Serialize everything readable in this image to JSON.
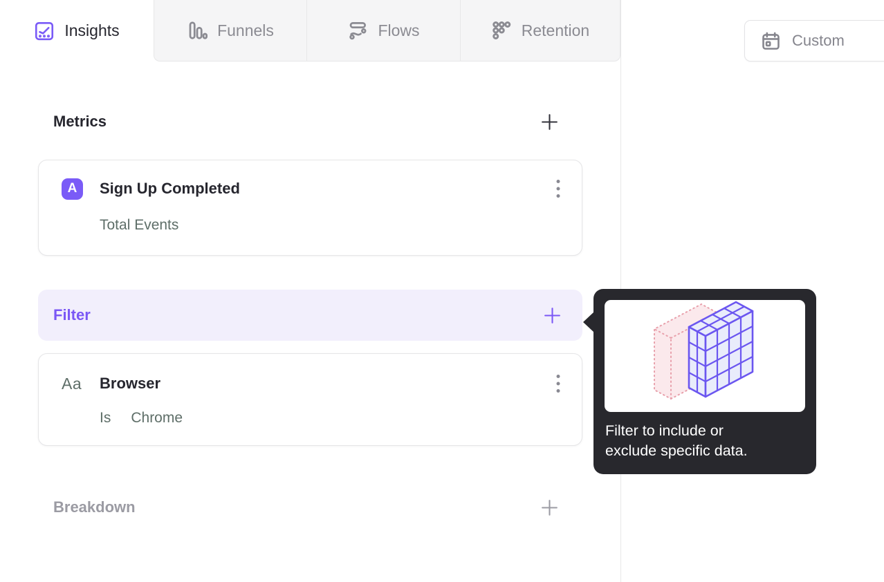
{
  "tabs": [
    {
      "label": "Insights",
      "icon": "insights-icon",
      "active": true
    },
    {
      "label": "Funnels",
      "icon": "funnels-icon",
      "active": false
    },
    {
      "label": "Flows",
      "icon": "flows-icon",
      "active": false
    },
    {
      "label": "Retention",
      "icon": "retention-icon",
      "active": false
    }
  ],
  "toolbar": {
    "date_range_label": "Custom",
    "icon": "calendar-icon"
  },
  "builder": {
    "metrics": {
      "title": "Metrics"
    },
    "metric_card": {
      "badge": "A",
      "title": "Sign Up Completed",
      "subtitle": "Total Events"
    },
    "filter": {
      "title": "Filter"
    },
    "filter_card": {
      "icon_label": "Aa",
      "title": "Browser",
      "operator": "Is",
      "value": "Chrome"
    },
    "breakdown": {
      "title": "Breakdown"
    }
  },
  "tooltip": {
    "text": "Filter to include or exclude specific data.",
    "illustration": "cube-grid-illustration"
  },
  "icons": {
    "insights": "line-chart-in-square",
    "funnels": "three-bars-descending",
    "flows": "bar-over-wave",
    "retention": "dot-staircase-grid",
    "calendar": "calendar",
    "plus": "plus-sign",
    "kebab": "vertical-three-dots"
  },
  "colors": {
    "accent_purple": "#7a5bf7",
    "filter_bg_lavender": "#f2effc",
    "tooltip_bg": "#28282d",
    "inactive_tab_bg": "#f5f5f6",
    "muted_text": "#5e6e68",
    "gray_text": "#8b8b92",
    "dark_text": "#26262e",
    "border": "#e5e5e7",
    "pink_cube": "#fbe9ec",
    "pink_stroke": "#e8a0ab",
    "purple_cube_fill": "#e9ecfb",
    "purple_cube_stroke": "#6b56f0"
  }
}
